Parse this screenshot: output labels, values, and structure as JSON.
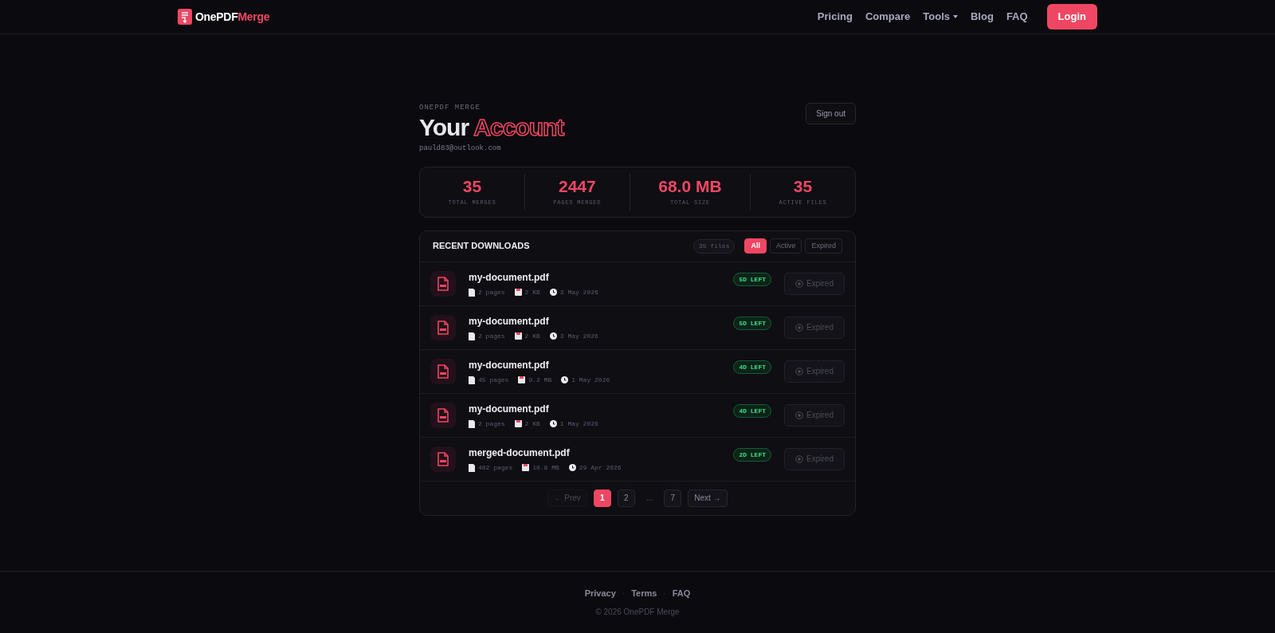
{
  "navbar": {
    "brand_main": "OnePDF",
    "brand_accent": "Merge",
    "links": [
      {
        "label": "Pricing",
        "dropdown": false
      },
      {
        "label": "Compare",
        "dropdown": false
      },
      {
        "label": "Tools",
        "dropdown": true
      },
      {
        "label": "Blog",
        "dropdown": false
      },
      {
        "label": "FAQ",
        "dropdown": false
      }
    ],
    "login": "Login"
  },
  "header": {
    "eyebrow": "ONEPDF MERGE",
    "title_plain": "Your",
    "title_outlined": "Account",
    "email": "pauld83@outlook.com",
    "sign_out": "Sign out"
  },
  "stats": [
    {
      "value": "35",
      "label": "TOTAL MERGES"
    },
    {
      "value": "2447",
      "label": "PAGES MERGED"
    },
    {
      "value": "68.0 MB",
      "label": "TOTAL SIZE"
    },
    {
      "value": "35",
      "label": "ACTIVE FILES"
    }
  ],
  "downloads": {
    "title": "RECENT DOWNLOADS",
    "count": "35 files",
    "filters": [
      {
        "label": "All",
        "selected": true
      },
      {
        "label": "Active",
        "selected": false
      },
      {
        "label": "Expired",
        "selected": false
      }
    ],
    "rows": [
      {
        "name": "my-document.pdf",
        "pages": "2 pages",
        "size": "2 KB",
        "date": "3 May 2026",
        "badge": "5D LEFT",
        "action": "Expired",
        "disabled": true
      },
      {
        "name": "my-document.pdf",
        "pages": "2 pages",
        "size": "2 KB",
        "date": "3 May 2026",
        "badge": "5D LEFT",
        "action": "Expired",
        "disabled": true
      },
      {
        "name": "my-document.pdf",
        "pages": "45 pages",
        "size": "9.2 MB",
        "date": "1 May 2026",
        "badge": "4D LEFT",
        "action": "Expired",
        "disabled": true
      },
      {
        "name": "my-document.pdf",
        "pages": "2 pages",
        "size": "2 KB",
        "date": "1 May 2026",
        "badge": "4D LEFT",
        "action": "Expired",
        "disabled": true
      },
      {
        "name": "merged-document.pdf",
        "pages": "402 pages",
        "size": "10.8 MB",
        "date": "29 Apr 2026",
        "badge": "2D LEFT",
        "action": "Expired",
        "disabled": true
      }
    ],
    "pagination": [
      {
        "kind": "prev",
        "label": "← Prev",
        "disabled": true
      },
      {
        "kind": "page",
        "label": "1",
        "selected": true
      },
      {
        "kind": "page",
        "label": "2",
        "selected": false
      },
      {
        "kind": "ellipsis",
        "label": "..."
      },
      {
        "kind": "page",
        "label": "7",
        "selected": false
      },
      {
        "kind": "next",
        "label": "Next →",
        "disabled": false
      }
    ]
  },
  "footer": {
    "links": [
      "Privacy",
      "Terms",
      "FAQ"
    ],
    "separator": "·",
    "copyright": "© 2026 OnePDF Merge"
  }
}
